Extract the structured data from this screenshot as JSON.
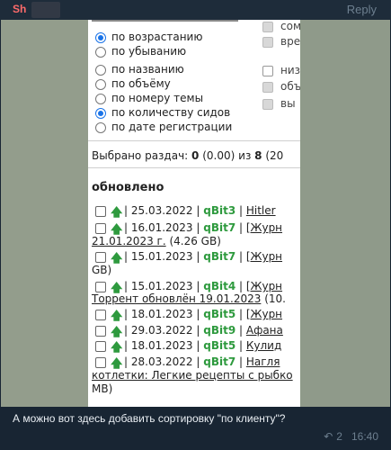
{
  "message": {
    "sender": "Sh",
    "reply_label": "Reply",
    "text": "А можно вот здесь добавить сортировку \"по клиенту\"?",
    "replies_count": "2",
    "time": "16:40"
  },
  "screenshot": {
    "right_column": [
      {
        "label": "сом",
        "checked": true
      },
      {
        "label": "вре",
        "checked": true
      },
      {
        "label": "низ",
        "checked": false
      },
      {
        "label": "объ",
        "checked": true
      },
      {
        "label": "вы",
        "checked": true
      }
    ],
    "order_options": [
      {
        "label": "по возрастанию",
        "selected": true
      },
      {
        "label": "по убыванию",
        "selected": false
      }
    ],
    "sort_options": [
      {
        "label": "по названию",
        "selected": false
      },
      {
        "label": "по объёму",
        "selected": false
      },
      {
        "label": "по номеру темы",
        "selected": false
      },
      {
        "label": "по количеству сидов",
        "selected": true
      },
      {
        "label": "по дате регистрации",
        "selected": false
      }
    ],
    "selected_prefix": "Выбрано раздач:",
    "selected_count": "0",
    "selected_size": "(0.00)",
    "selected_of": "из",
    "selected_total": "8",
    "selected_tail": "(20",
    "section_title": "обновлено",
    "rows": [
      {
        "date": "25.03.2022",
        "client": "qBit3",
        "title": "Hitler"
      },
      {
        "date": "16.01.2023",
        "client": "qBit7",
        "title": "[Журн"
      },
      {
        "date": "15.01.2023",
        "client": "qBit7",
        "title": "[Журн"
      },
      {
        "date": "15.01.2023",
        "client": "qBit4",
        "title": "[Журн"
      },
      {
        "date": "18.01.2023",
        "client": "qBit5",
        "title": "[Журн"
      },
      {
        "date": "29.03.2022",
        "client": "qBit9",
        "title": "Афана"
      },
      {
        "date": "18.01.2023",
        "client": "qBit5",
        "title": "Кулид"
      },
      {
        "date": "28.03.2022",
        "client": "qBit7",
        "title": "Нагля"
      }
    ],
    "continuations": {
      "c1_link": "21.01.2023 г.",
      "c1_rest": "(4.26 GB)",
      "c2": "GB)",
      "c3_link": "Торрент обновлён 19.01.2023",
      "c3_rest": "(10.",
      "c4_link": "котлетки: Легкие рецепты с рыбко",
      "c5": "MB)"
    }
  },
  "colors": {
    "sender": "#ff6b6b",
    "client_green": "#2e9a3e",
    "radio_blue": "#1a73e8",
    "chat_bg": "#182533"
  }
}
